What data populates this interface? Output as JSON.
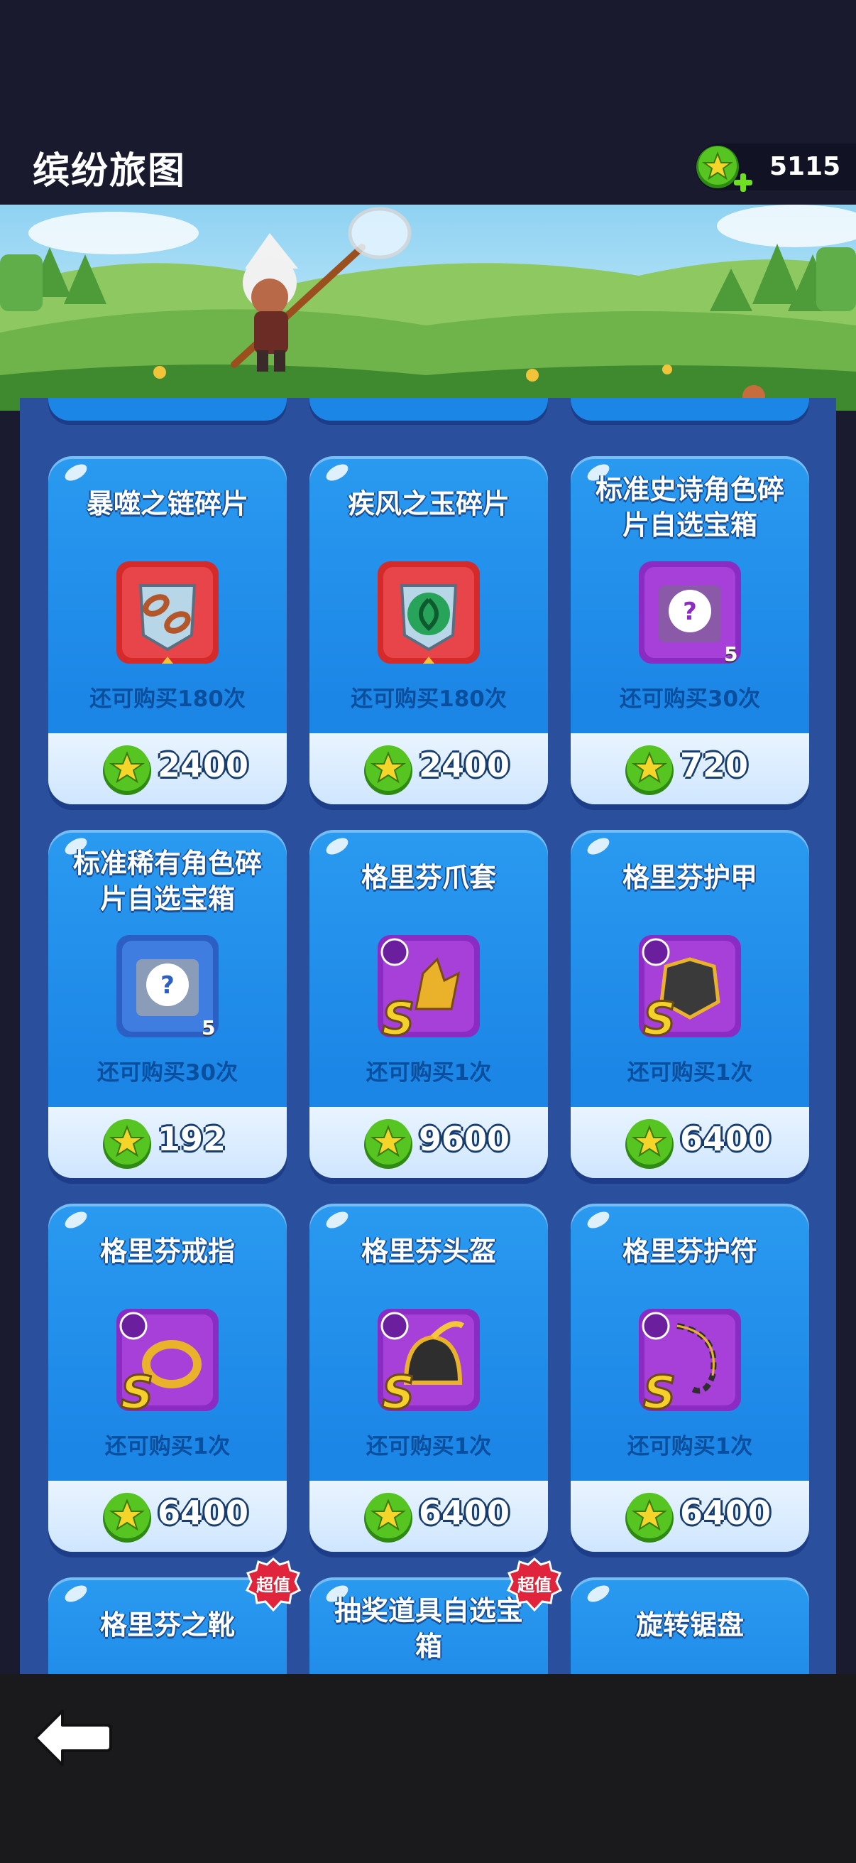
{
  "header": {
    "title": "缤纷旅图",
    "currency_amount": "5115"
  },
  "cards": [
    {
      "name": "暴噬之链碎片",
      "limit": "还可购买180次",
      "price": "2400",
      "icon": "chain-shard-icon"
    },
    {
      "name": "疾风之玉碎片",
      "limit": "还可购买180次",
      "price": "2400",
      "icon": "wind-jade-shard-icon"
    },
    {
      "name": "标准史诗角色碎片自选宝箱",
      "name_line1": "标准史诗角色碎",
      "name_line2": "片自选宝箱",
      "limit": "还可购买30次",
      "price": "720",
      "icon": "epic-chest-icon",
      "count": "5"
    },
    {
      "name": "标准稀有角色碎片自选宝箱",
      "name_line1": "标准稀有角色碎",
      "name_line2": "片自选宝箱",
      "limit": "还可购买30次",
      "price": "192",
      "icon": "rare-chest-icon",
      "count": "5"
    },
    {
      "name": "格里芬爪套",
      "limit": "还可购买1次",
      "price": "9600",
      "icon": "griffin-claw-icon"
    },
    {
      "name": "格里芬护甲",
      "limit": "还可购买1次",
      "price": "6400",
      "icon": "griffin-armor-icon"
    },
    {
      "name": "格里芬戒指",
      "limit": "还可购买1次",
      "price": "6400",
      "icon": "griffin-ring-icon"
    },
    {
      "name": "格里芬头盔",
      "limit": "还可购买1次",
      "price": "6400",
      "icon": "griffin-helmet-icon"
    },
    {
      "name": "格里芬护符",
      "limit": "还可购买1次",
      "price": "6400",
      "icon": "griffin-amulet-icon"
    },
    {
      "name": "格里芬之靴",
      "badge": "超值"
    },
    {
      "name": "抽奖道具自选宝箱",
      "name_line1": "抽奖道具自选宝",
      "name_line2": "箱",
      "badge": "超值"
    },
    {
      "name": "旋转锯盘"
    }
  ],
  "grade_letter": "S",
  "colors": {
    "card_blue": "#1c86e6",
    "coin_green": "#4cbf1f",
    "badge_red": "#e0243b"
  }
}
